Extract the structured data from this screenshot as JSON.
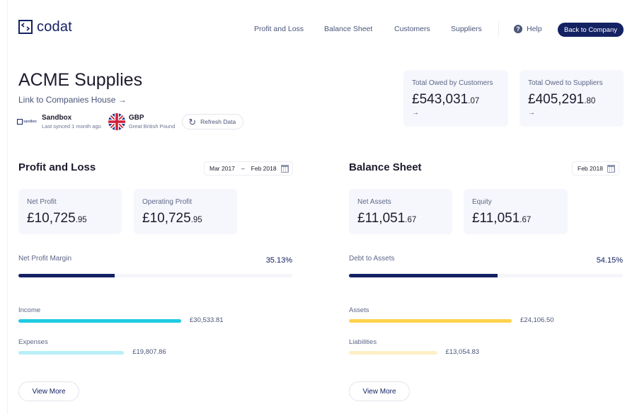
{
  "header": {
    "logo_text": "codat",
    "nav": [
      {
        "label": "Profit and Loss"
      },
      {
        "label": "Balance Sheet"
      },
      {
        "label": "Customers"
      },
      {
        "label": "Suppliers"
      }
    ],
    "help_label": "Help",
    "help_icon": "?",
    "back_button": "Back to Company"
  },
  "company": {
    "name": "ACME Supplies",
    "companies_house_link": "Link to Companies House →",
    "platform": {
      "logo_text": "sandbox",
      "name": "Sandbox",
      "status": "Last synced 1 month ago"
    },
    "currency": {
      "code": "GBP",
      "name": "Great British Pound"
    },
    "refresh_label": "Refresh Data",
    "refresh_icon": "↻"
  },
  "totals": [
    {
      "label": "Total Owed by Customers",
      "value_main": "£543,031",
      "value_cents": ".07",
      "arrow": "→"
    },
    {
      "label": "Total Owed to Suppliers",
      "value_main": "£405,291",
      "value_cents": ".80",
      "arrow": "→"
    }
  ],
  "profit_and_loss": {
    "title": "Profit and Loss",
    "date_from": "Mar 2017",
    "date_sep": "–",
    "date_to": "Feb 2018",
    "cards": [
      {
        "label": "Net Profit",
        "value_main": "£10,725",
        "value_cents": ".95"
      },
      {
        "label": "Operating Profit",
        "value_main": "£10,725",
        "value_cents": ".95"
      }
    ],
    "ratio": {
      "label": "Net Profit Margin",
      "value_text": "35.13%",
      "value": 0.3513
    },
    "bars": [
      {
        "label": "Income",
        "value_text": "£30,533.81",
        "value": 30533.81,
        "color": "#1ecbe1"
      },
      {
        "label": "Expenses",
        "value_text": "£19,807.86",
        "value": 19807.86,
        "color": "#b9eff7"
      }
    ],
    "view_more": "View More"
  },
  "balance_sheet": {
    "title": "Balance Sheet",
    "date": "Feb 2018",
    "cards": [
      {
        "label": "Net Assets",
        "value_main": "£11,051",
        "value_cents": ".67"
      },
      {
        "label": "Equity",
        "value_main": "£11,051",
        "value_cents": ".67"
      }
    ],
    "ratio": {
      "label": "Debt to Assets",
      "value_text": "54.15%",
      "value": 0.5415
    },
    "bars": [
      {
        "label": "Assets",
        "value_text": "£24,106.50",
        "value": 24106.5,
        "color": "#fdd34f"
      },
      {
        "label": "Liabilities",
        "value_text": "£13,054.83",
        "value": 13054.83,
        "color": "#fdefc6"
      }
    ],
    "view_more": "View More"
  }
}
